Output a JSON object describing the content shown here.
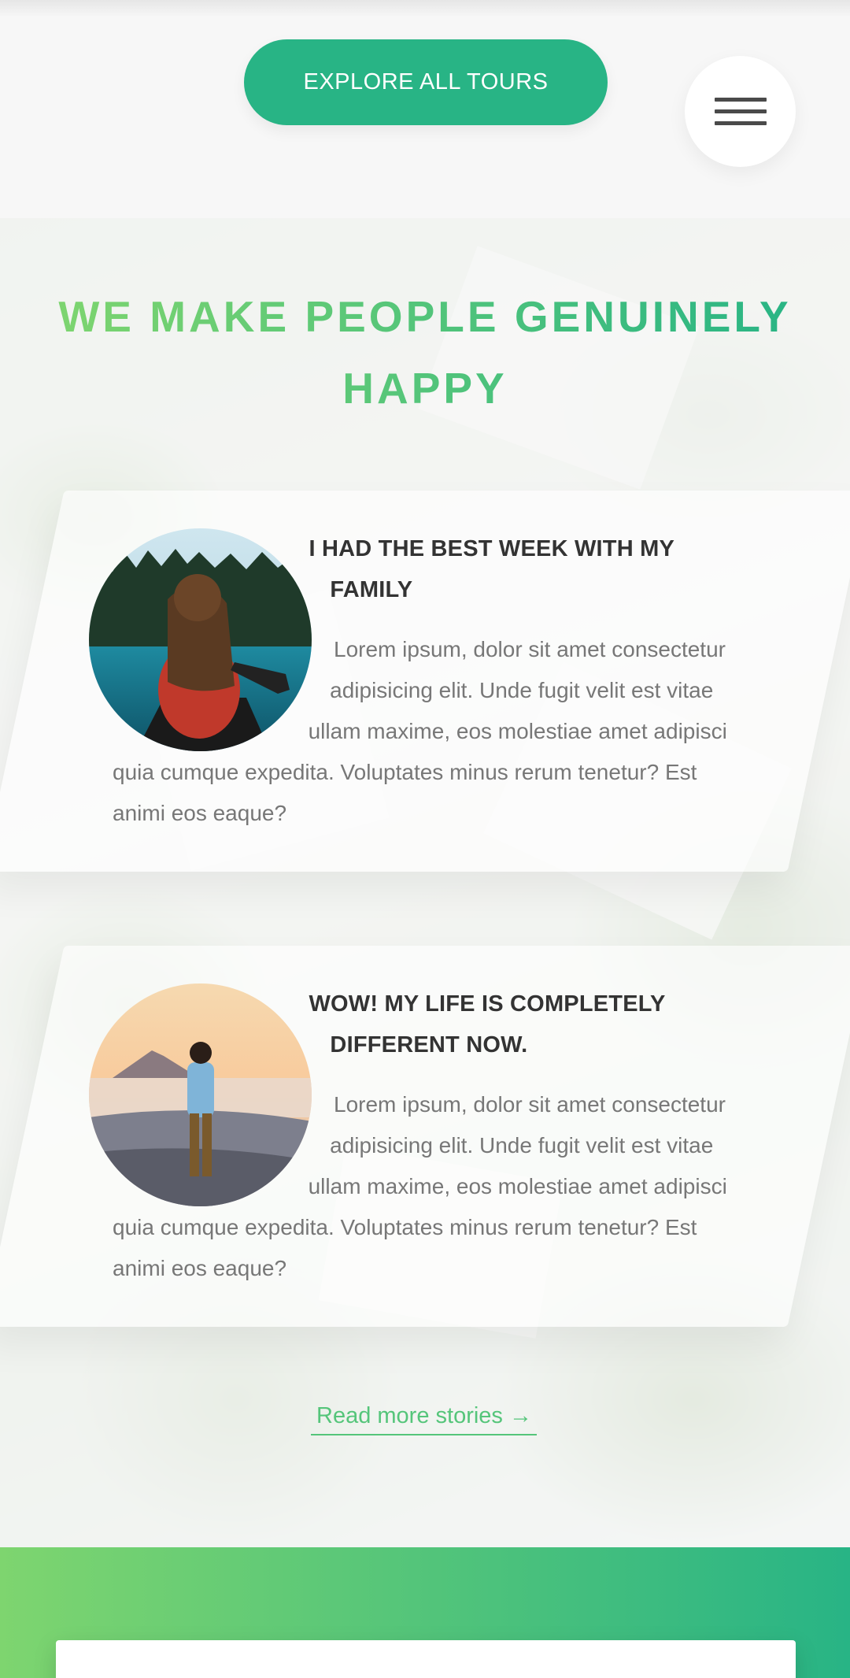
{
  "header": {
    "explore_button_label": "EXPLORE ALL TOURS",
    "menu_icon": "hamburger-menu-icon"
  },
  "stories": {
    "heading": "WE MAKE PEOPLE GENUINELY HAPPY",
    "items": [
      {
        "title": "I HAD THE BEST WEEK WITH MY FAMILY",
        "text": "Lorem ipsum, dolor sit amet consectetur adipisicing elit. Unde fugit velit est vitae ullam maxime, eos molestiae amet adipisci quia cumque expedita. Voluptates minus rerum tenetur? Est animi eos eaque?"
      },
      {
        "title": "WOW! MY LIFE IS COMPLETELY DIFFERENT NOW.",
        "text": "Lorem ipsum, dolor sit amet consectetur adipisicing elit. Unde fugit velit est vitae ullam maxime, eos molestiae amet adipisci quia cumque expedita. Voluptates minus rerum tenetur? Est animi eos eaque?"
      }
    ],
    "read_more_label": "Read more stories →"
  },
  "colors": {
    "primary_green": "#28b485",
    "light_green": "#7ed56f",
    "link_green": "#55c57a"
  }
}
